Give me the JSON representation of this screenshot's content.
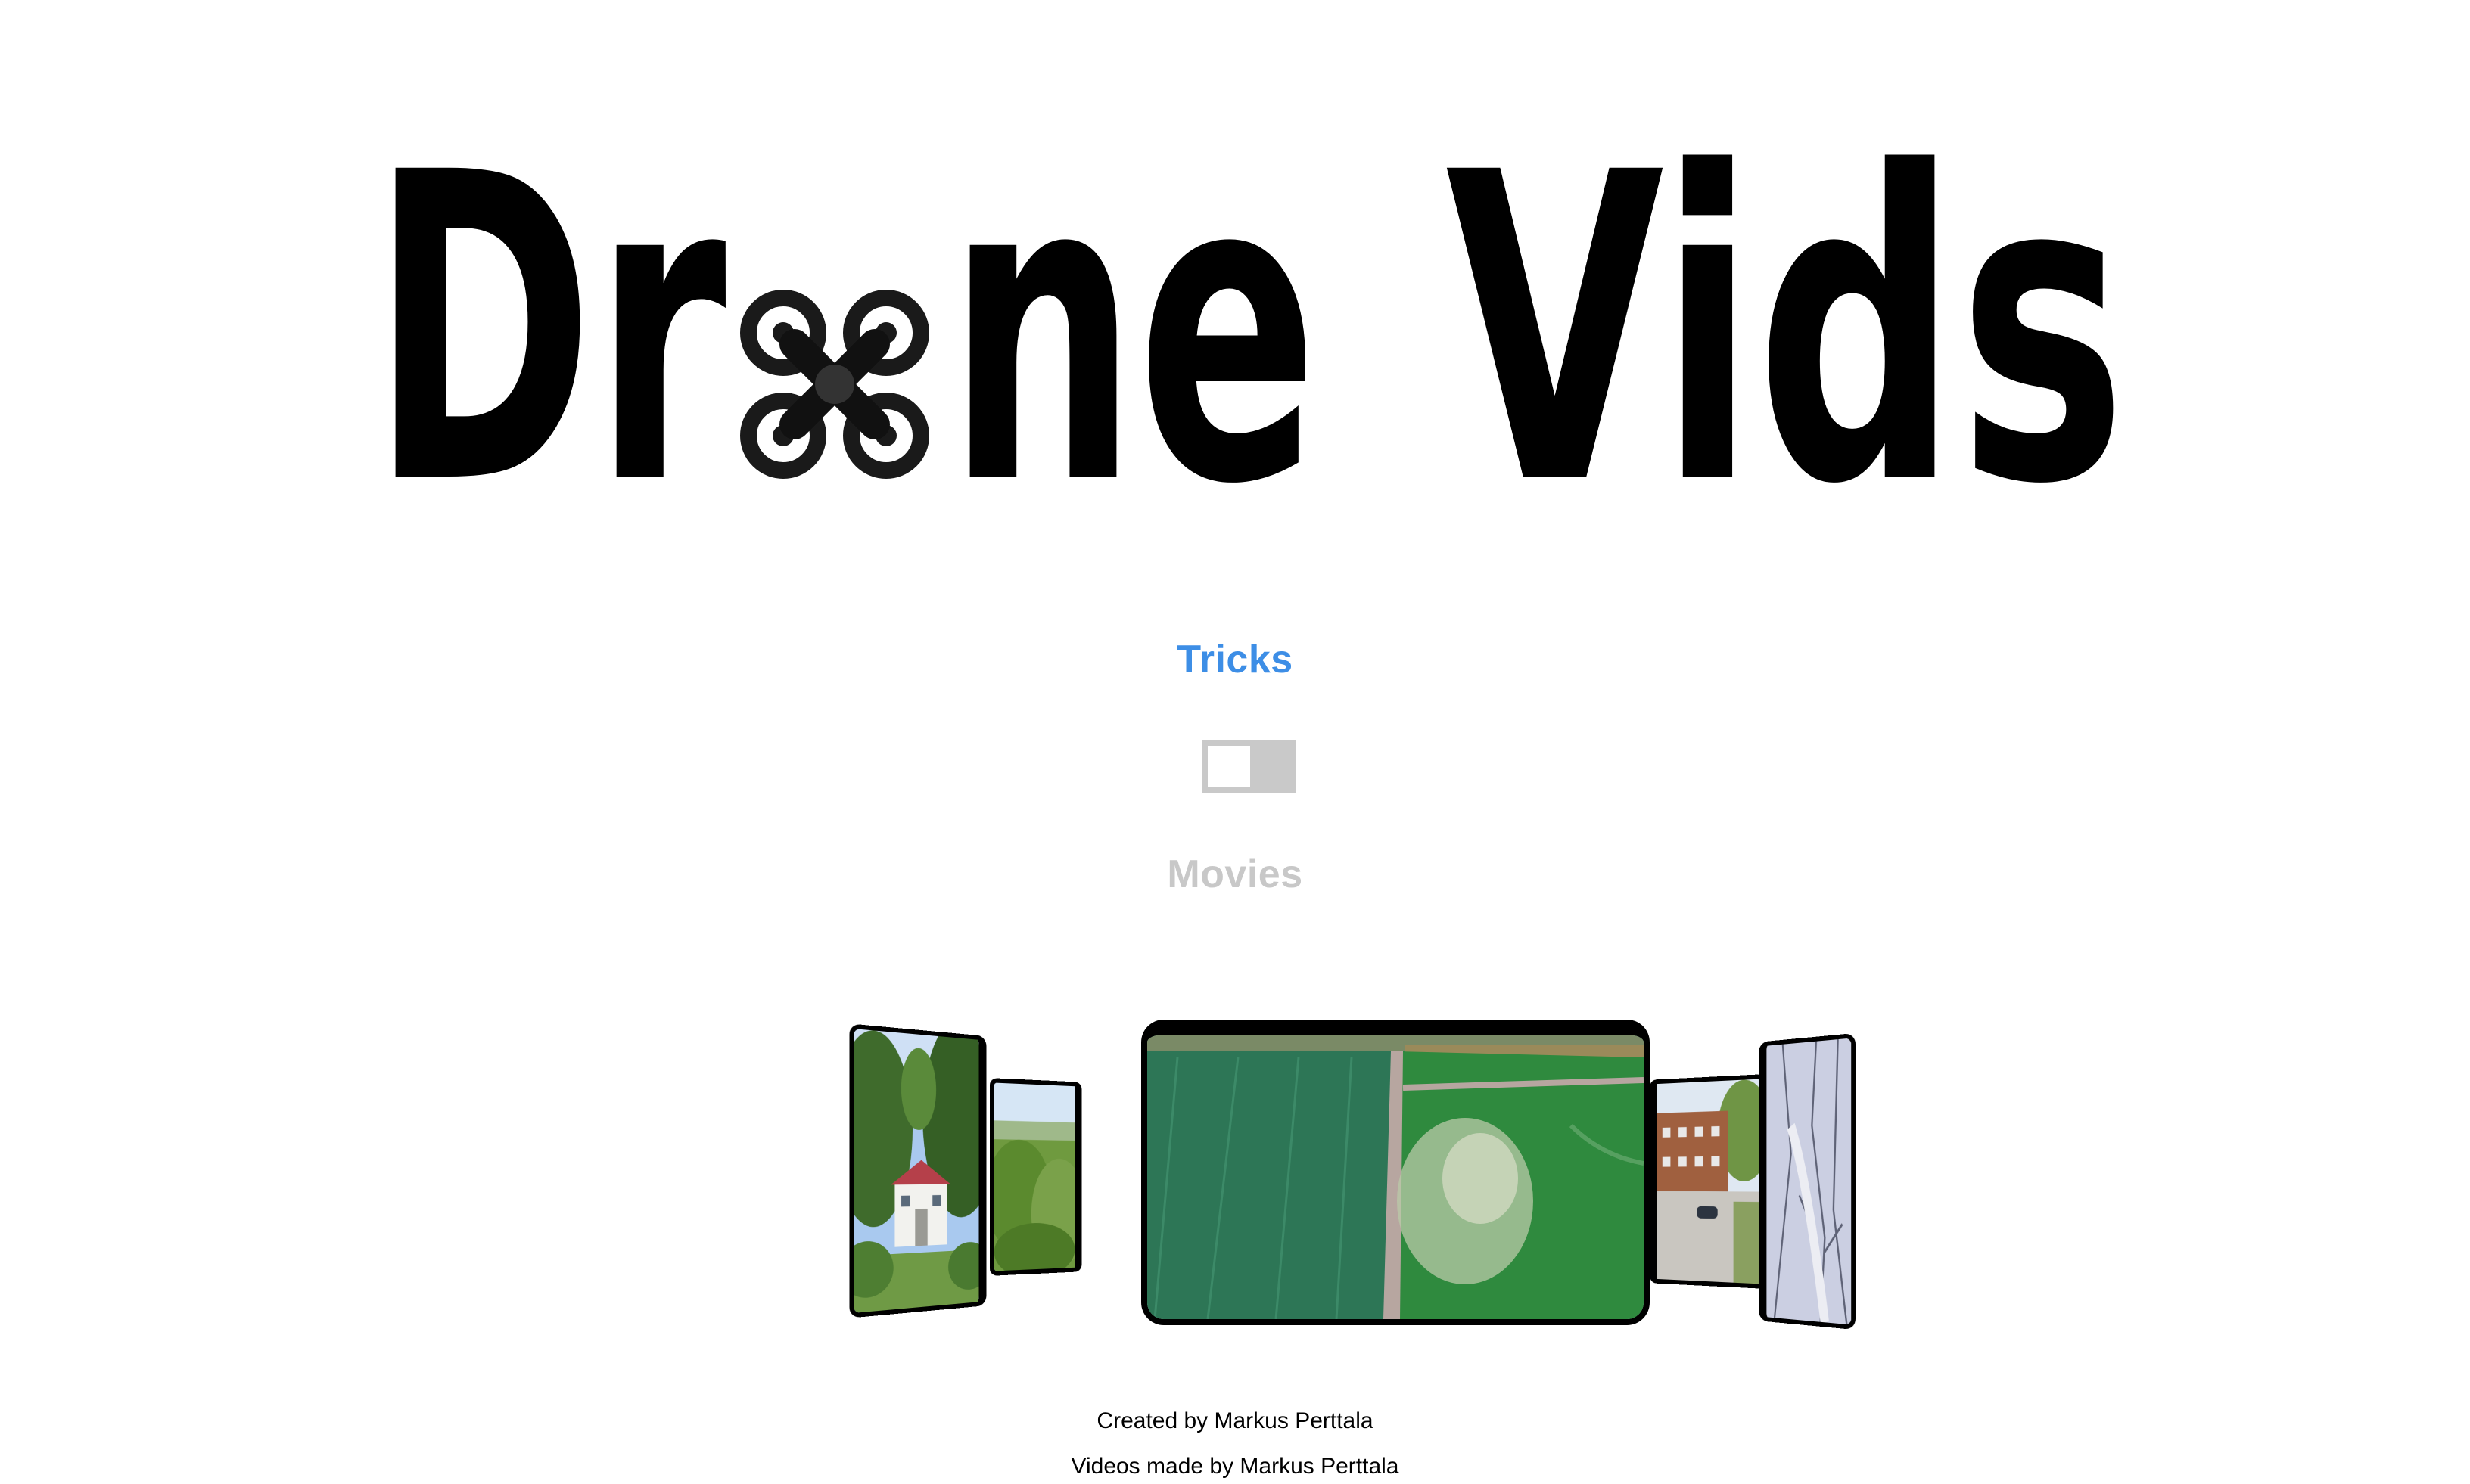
{
  "header": {
    "logo_text": "Drone Vids",
    "logo_icon": "quadcopter-drone-icon"
  },
  "mode_switch": {
    "option_top": "Tricks",
    "option_bottom": "Movies",
    "selected": "Tricks",
    "active_color": "#3d8ee6",
    "inactive_color": "#c8c8c8"
  },
  "carousel": {
    "slides": [
      {
        "position": "left-far",
        "scene": "white house among trees"
      },
      {
        "position": "left-near",
        "scene": "tree canopy"
      },
      {
        "position": "center",
        "scene": "green farm fields with road"
      },
      {
        "position": "right-near",
        "scene": "brick building and parking lot"
      },
      {
        "position": "right-far",
        "scene": "snowy forest road"
      }
    ]
  },
  "footer": {
    "created_by": "Created by Markus Perttala",
    "videos_by": "Videos made by Markus Perttala"
  },
  "colors": {
    "background": "#ffffff",
    "logo": "#000000",
    "toggle_track": "#c9c9c9"
  }
}
